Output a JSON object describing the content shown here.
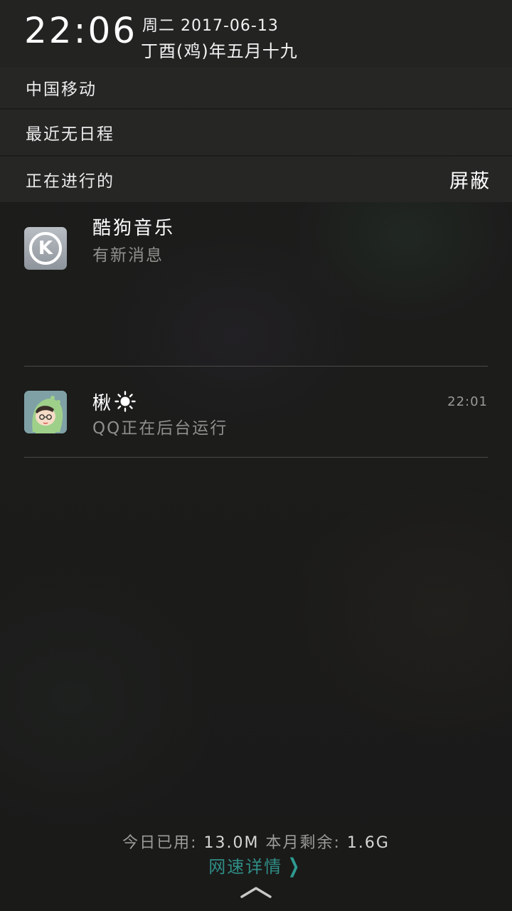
{
  "header": {
    "time": "22:06",
    "date": "周二 2017-06-13",
    "lunar_date": "丁酉(鸡)年五月十九"
  },
  "carrier": "中国移动",
  "schedule": "最近无日程",
  "ongoing": {
    "label": "正在进行的",
    "block_label": "屏蔽"
  },
  "notifications": [
    {
      "app": "kugou",
      "icon": "kugou-k-icon",
      "title": "酷狗音乐",
      "subtitle": "有新消息"
    },
    {
      "app": "qq",
      "icon": "qq-avatar-icon",
      "title": "楸",
      "title_icon": "sun-icon",
      "subtitle": "QQ正在后台运行",
      "time": "22:01"
    }
  ],
  "footer": {
    "today_label": "今日已用:",
    "today_value": "13.0M",
    "month_label": "本月剩余:",
    "month_value": "1.6G",
    "speed_link": "网速详情",
    "speed_link_icon": "chevron-right-icon",
    "collapse_icon": "chevron-up-icon"
  },
  "colors": {
    "accent": "#2f8e86",
    "background": "#1b1b1a",
    "row_background": "#262625"
  }
}
